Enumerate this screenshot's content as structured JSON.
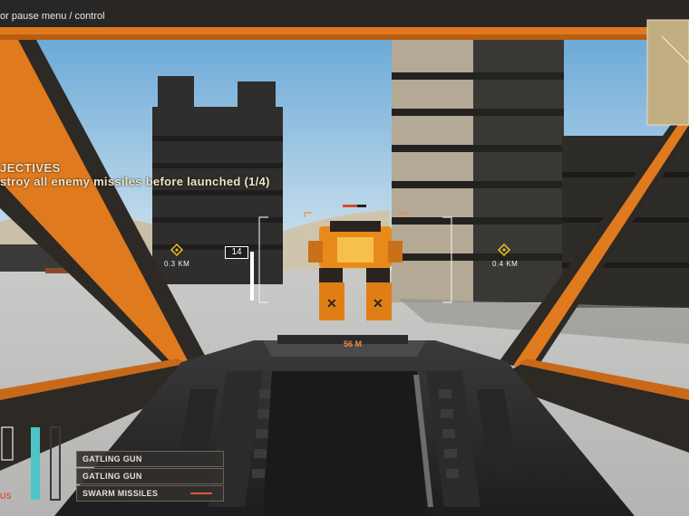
{
  "hud": {
    "pause_hint": "or pause menu / controls",
    "objectives_title": "JECTIVES",
    "objective_text": "stroy all enemy missiles before launched (1/4)",
    "left_marker_distance": "0.3 KM",
    "right_marker_distance": "0.4 KM",
    "range_box_value": "14",
    "target_distance": "56 M",
    "side_label": "US"
  },
  "weapons": {
    "slots": [
      {
        "label": "GATLING GUN"
      },
      {
        "label": "GATLING GUN"
      },
      {
        "label": "SWARM MISSILES"
      }
    ]
  },
  "bars": {
    "left_bar_level": 0.0,
    "cyan_bar_level": 1.0,
    "dark_bar_level": 1.0
  },
  "colors": {
    "frame_orange": "#e07a1e",
    "hud_orange": "#f08a3a",
    "sky": "#a7cfe8",
    "bar_cyan": "#4fc4c8",
    "enemy_orange": "#e88a1a"
  },
  "icons": {
    "waypoint": "diamond-marker-icon",
    "minimap": "minimap-icon"
  }
}
